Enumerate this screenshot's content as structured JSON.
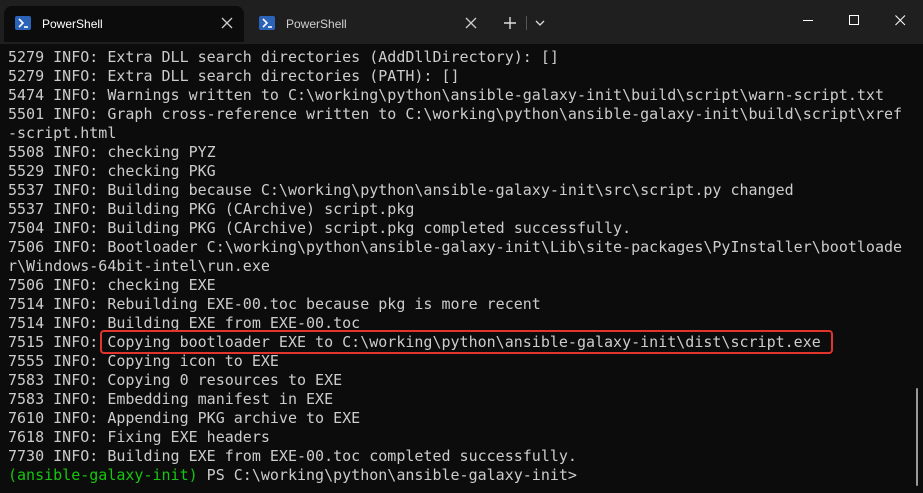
{
  "tabs": [
    {
      "label": "PowerShell",
      "active": true
    },
    {
      "label": "PowerShell",
      "active": false
    }
  ],
  "colors": {
    "background": "#0c0c0c",
    "titlebar": "#1f1f1f",
    "text": "#cccccc",
    "prompt_env": "#16c60c",
    "highlight_border": "#e0342c",
    "ps_icon": "#2b63b9"
  },
  "icons": {
    "tab_icon": "powershell-icon",
    "tab_close": "close-icon",
    "new_tab": "plus-icon",
    "dropdown": "chevron-down-icon",
    "minimize": "minimize-icon",
    "maximize": "maximize-icon",
    "close": "close-icon"
  },
  "terminal": {
    "lines": [
      "5279 INFO: Extra DLL search directories (AddDllDirectory): []",
      "5279 INFO: Extra DLL search directories (PATH): []",
      "5474 INFO: Warnings written to C:\\working\\python\\ansible-galaxy-init\\build\\script\\warn-script.txt",
      "5501 INFO: Graph cross-reference written to C:\\working\\python\\ansible-galaxy-init\\build\\script\\xref",
      "-script.html",
      "5508 INFO: checking PYZ",
      "5529 INFO: checking PKG",
      "5537 INFO: Building because C:\\working\\python\\ansible-galaxy-init\\src\\script.py changed",
      "5537 INFO: Building PKG (CArchive) script.pkg",
      "7504 INFO: Building PKG (CArchive) script.pkg completed successfully.",
      "7506 INFO: Bootloader C:\\working\\python\\ansible-galaxy-init\\Lib\\site-packages\\PyInstaller\\bootloade",
      "r\\Windows-64bit-intel\\run.exe",
      "7506 INFO: checking EXE",
      "7514 INFO: Rebuilding EXE-00.toc because pkg is more recent",
      "7514 INFO: Building EXE from EXE-00.toc",
      "7515 INFO: Copying bootloader EXE to C:\\working\\python\\ansible-galaxy-init\\dist\\script.exe",
      "7555 INFO: Copying icon to EXE",
      "7583 INFO: Copying 0 resources to EXE",
      "7583 INFO: Embedding manifest in EXE",
      "7610 INFO: Appending PKG archive to EXE",
      "7618 INFO: Fixing EXE headers",
      "7730 INFO: Building EXE from EXE-00.toc completed successfully."
    ],
    "prompt": {
      "env": "(ansible-galaxy-init)",
      "text": " PS C:\\working\\python\\ansible-galaxy-init>"
    }
  }
}
